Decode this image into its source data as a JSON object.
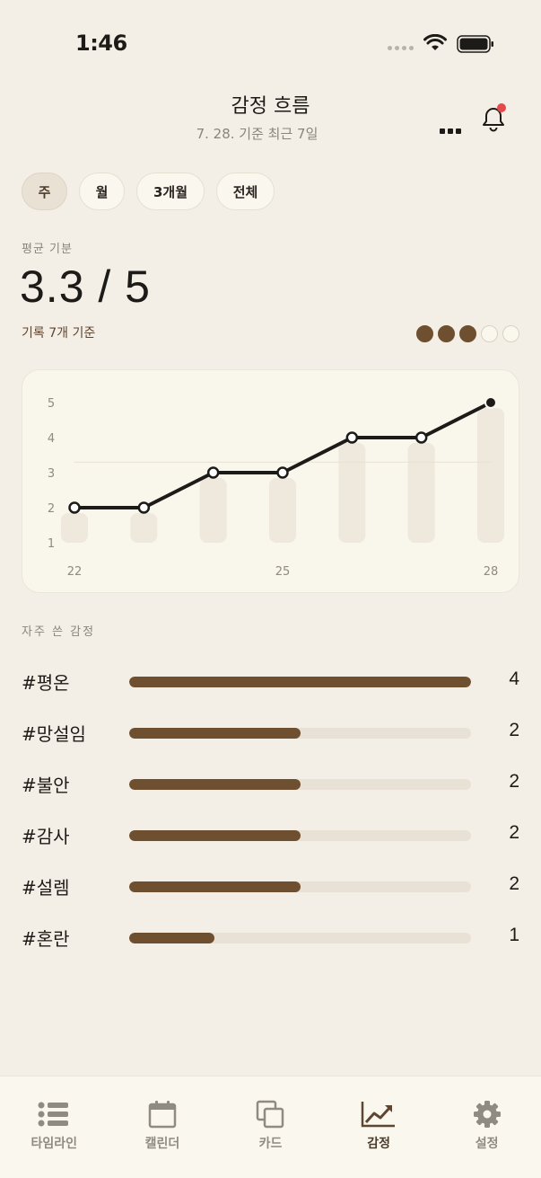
{
  "status_bar": {
    "time": "1:46"
  },
  "header": {
    "title": "감정 흐름",
    "subtitle": "7. 28. 기준 최근 7일"
  },
  "period_tabs": [
    {
      "label": "주",
      "active": true
    },
    {
      "label": "월",
      "active": false
    },
    {
      "label": "3개월",
      "active": false
    },
    {
      "label": "전체",
      "active": false
    }
  ],
  "average": {
    "label": "평균 기분",
    "value": "3.3 / 5",
    "count_text": "기록 7개 기준",
    "level": 3,
    "max": 5
  },
  "chart_data": {
    "type": "line",
    "x": [
      22,
      23,
      24,
      25,
      26,
      27,
      28
    ],
    "x_tick_labels": [
      "22",
      "25",
      "28"
    ],
    "values": [
      2,
      2,
      3,
      3,
      4,
      4,
      5
    ],
    "ylim": [
      1,
      5
    ],
    "y_ticks": [
      "1",
      "2",
      "3",
      "4",
      "5"
    ],
    "reference_line": 3.3,
    "background_bars": true,
    "title": "",
    "xlabel": "",
    "ylabel": ""
  },
  "frequent_emotions": {
    "label": "자주 쓴 감정",
    "max": 4,
    "items": [
      {
        "name": "#평온",
        "count": 4
      },
      {
        "name": "#망설임",
        "count": 2
      },
      {
        "name": "#불안",
        "count": 2
      },
      {
        "name": "#감사",
        "count": 2
      },
      {
        "name": "#설렘",
        "count": 2
      },
      {
        "name": "#혼란",
        "count": 1
      }
    ]
  },
  "tab_bar": [
    {
      "label": "타임라인",
      "icon": "list-icon",
      "active": false
    },
    {
      "label": "캘린더",
      "icon": "calendar-icon",
      "active": false
    },
    {
      "label": "카드",
      "icon": "cards-icon",
      "active": false
    },
    {
      "label": "감정",
      "icon": "trend-chart-icon",
      "active": true
    },
    {
      "label": "설정",
      "icon": "gear-icon",
      "active": false
    }
  ],
  "colors": {
    "background": "#f4efe6",
    "accent_brown": "#6e4f2f",
    "notification_dot": "#e5484d",
    "line": "#1d1b18"
  }
}
